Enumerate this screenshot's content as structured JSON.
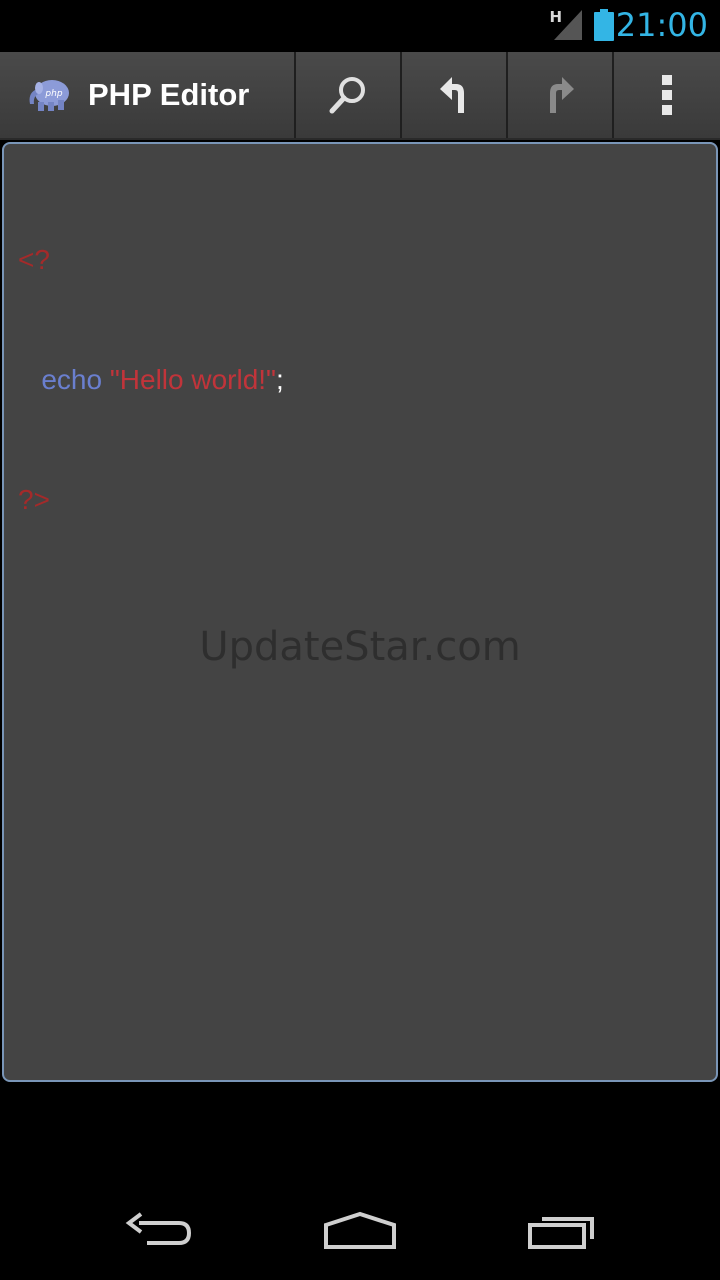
{
  "status_bar": {
    "network_type": "H",
    "time": "21:00",
    "icons": [
      "signal-icon",
      "battery-icon"
    ]
  },
  "action_bar": {
    "title": "PHP Editor",
    "app_icon": "php-elephant-icon",
    "buttons": [
      {
        "icon": "search-icon"
      },
      {
        "icon": "undo-icon"
      },
      {
        "icon": "redo-icon"
      },
      {
        "icon": "overflow-menu-icon"
      }
    ]
  },
  "editor": {
    "lines": [
      {
        "tokens": [
          {
            "text": "<?",
            "type": "php-tag"
          }
        ]
      },
      {
        "tokens": [
          {
            "text": "   echo",
            "type": "keyword"
          },
          {
            "text": " \"Hello world!\"",
            "type": "string"
          },
          {
            "text": ";",
            "type": "punct"
          }
        ]
      },
      {
        "tokens": [
          {
            "text": "?>",
            "type": "php-tag"
          }
        ]
      }
    ],
    "line1_tag": "<?",
    "line2_keyword": "echo",
    "line2_string": "\"Hello world!\"",
    "line2_punct": ";",
    "line3_tag": "?>"
  },
  "watermark": "UpdateStar.com",
  "nav_bar": {
    "buttons": [
      "back-icon",
      "home-icon",
      "recents-icon"
    ]
  },
  "colors": {
    "accent": "#33b5e5",
    "php_tag": "#a42a2a",
    "keyword": "#6a7fcf",
    "string": "#c1343a",
    "editor_bg": "#444444",
    "editor_border": "#7a96b8"
  }
}
